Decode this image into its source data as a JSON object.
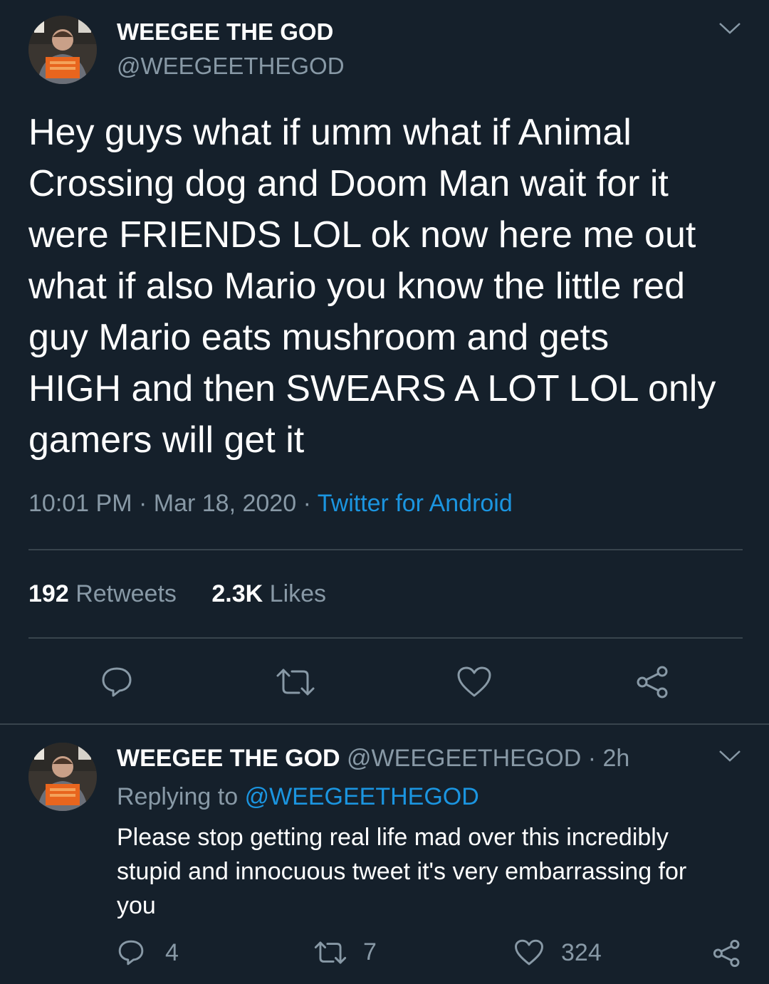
{
  "main_tweet": {
    "author_name": "WEEGEE THE GOD",
    "author_handle": "@WEEGEETHEGOD",
    "text_lines": [
      "Hey guys what if umm what if Animal",
      "Crossing dog and Doom Man wait for it",
      "were FRIENDS LOL ok now here me out",
      "what if also Mario you know the little red",
      "guy Mario eats mushroom and gets",
      "HIGH and then SWEARS A LOT LOL only",
      "gamers will get it"
    ],
    "time": "10:01 PM",
    "sep1": "·",
    "date": "Mar 18, 2020",
    "sep2": "·",
    "source": "Twitter for Android",
    "retweets_count": "192",
    "retweets_label": "Retweets",
    "likes_count": "2.3K",
    "likes_label": "Likes"
  },
  "reply": {
    "author_name": "WEEGEE THE GOD",
    "author_handle": "@WEEGEETHEGOD",
    "sep": "·",
    "age": "2h",
    "replying_prefix": "Replying to",
    "replying_handle": "@WEEGEETHEGOD",
    "text_lines": [
      "Please stop getting real life mad over this incredibly",
      "stupid and innocuous tweet it's very embarrassing for",
      "you"
    ],
    "reply_count": "4",
    "retweet_count": "7",
    "like_count": "324"
  },
  "icons": {
    "caret": "chevron-down-icon",
    "reply": "reply-icon",
    "retweet": "retweet-icon",
    "like": "heart-icon",
    "share": "share-icon"
  },
  "colors": {
    "background": "#15202b",
    "muted": "#8899a6",
    "link": "#1b95e0",
    "divider": "#38444d"
  }
}
